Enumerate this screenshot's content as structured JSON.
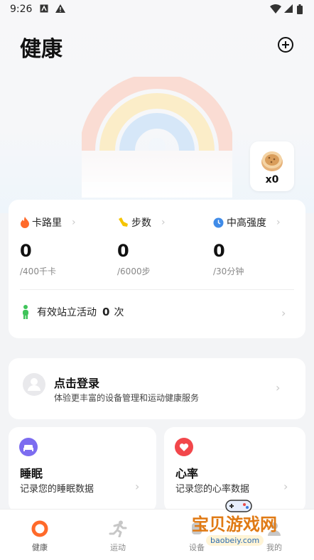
{
  "status_bar": {
    "time": "9:26"
  },
  "header": {
    "title": "健康"
  },
  "cookie": {
    "count": "x0"
  },
  "stats": [
    {
      "label": "卡路里",
      "value": "0",
      "goal": "/400千卡",
      "icon": "flame-icon",
      "color": "#ff6a2a"
    },
    {
      "label": "步数",
      "value": "0",
      "goal": "/6000步",
      "icon": "shoe-icon",
      "color": "#f5c400"
    },
    {
      "label": "中高强度",
      "value": "0",
      "goal": "/30分钟",
      "icon": "clock-icon",
      "color": "#3f8be8"
    }
  ],
  "stand": {
    "label": "有效站立活动",
    "count": "0",
    "unit": "次"
  },
  "login": {
    "title": "点击登录",
    "subtitle": "体验更丰富的设备管理和运动健康服务"
  },
  "sleep": {
    "title": "睡眠",
    "subtitle": "记录您的睡眠数据",
    "color": "#7c6cf0"
  },
  "heart": {
    "title": "心率",
    "subtitle": "记录您的心率数据",
    "color": "#f2474b"
  },
  "tabs": [
    {
      "label": "健康",
      "active": true
    },
    {
      "label": "运动"
    },
    {
      "label": "设备"
    },
    {
      "label": "我的"
    }
  ],
  "watermark": {
    "text": "宝贝游戏网",
    "url": "baobeiy.com"
  }
}
